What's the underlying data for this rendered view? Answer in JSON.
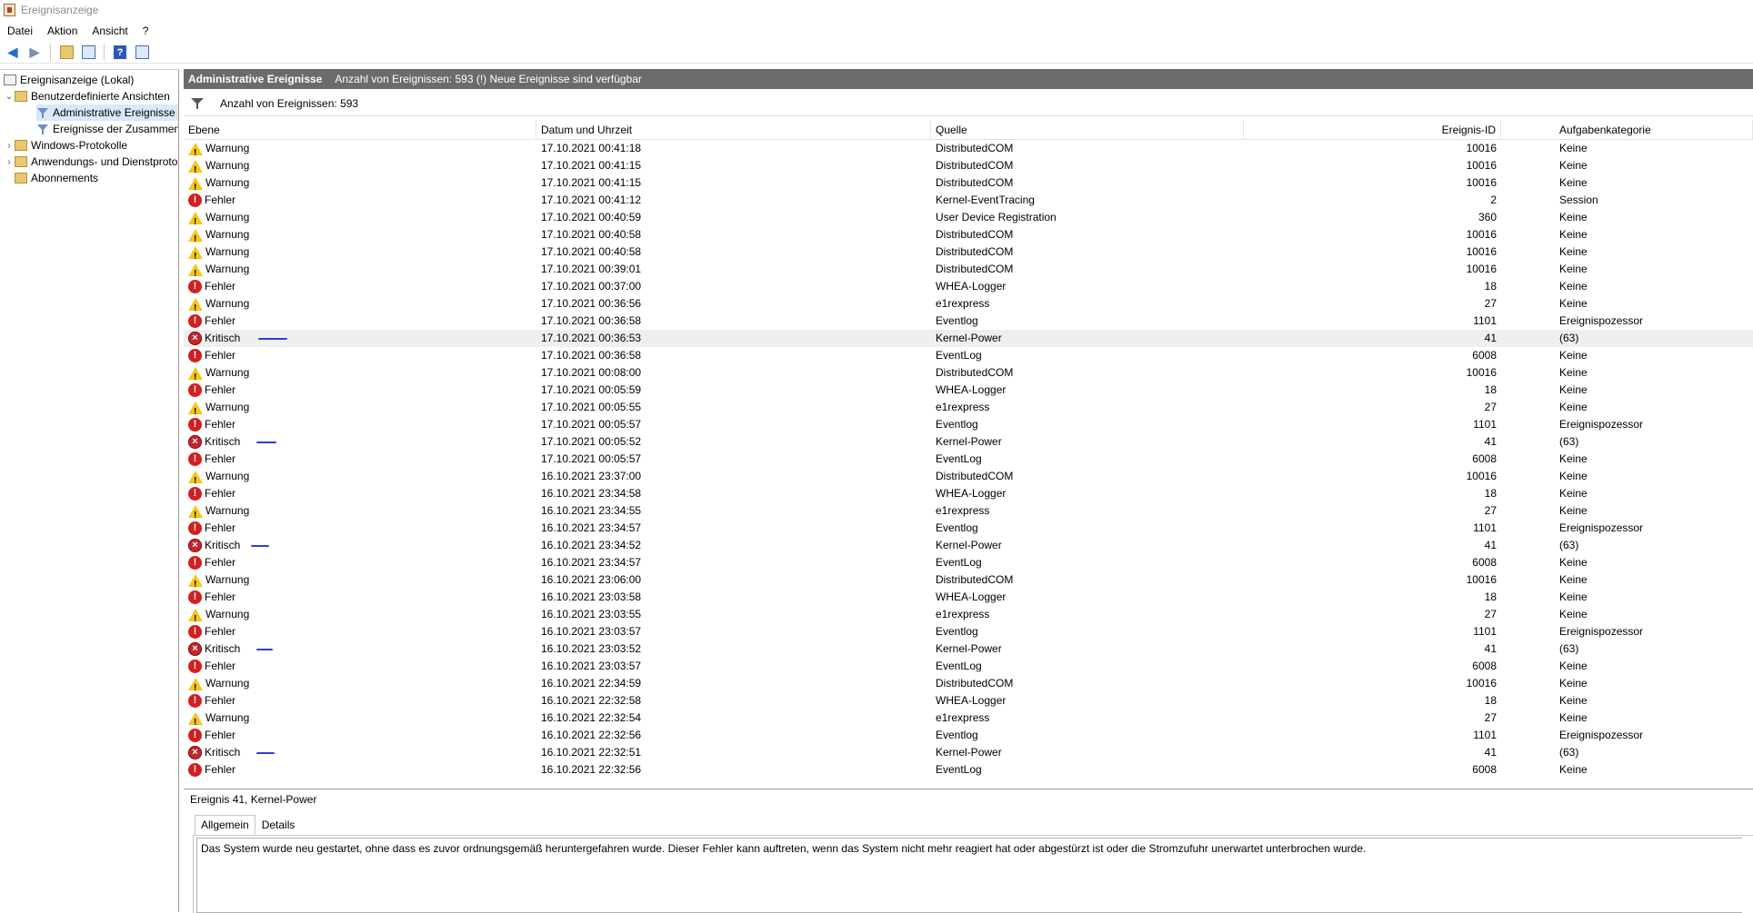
{
  "window": {
    "title": "Ereignisanzeige"
  },
  "menu": [
    "Datei",
    "Aktion",
    "Ansicht",
    "?"
  ],
  "toolbar": {
    "icons": [
      "back-arrow-icon",
      "forward-arrow-icon",
      "folder-up-icon",
      "properties-icon",
      "help-icon",
      "panel-icon"
    ]
  },
  "tree": {
    "root": "Ereignisanzeige (Lokal)",
    "custom_views": "Benutzerdefinierte Ansichten",
    "admin_events": "Administrative Ereignisse",
    "summary_events": "Ereignisse der Zusammenfassung",
    "windows_logs": "Windows-Protokolle",
    "app_service_logs": "Anwendungs- und Dienstprotokolle",
    "subscriptions": "Abonnements"
  },
  "header": {
    "title": "Administrative Ereignisse",
    "status": "Anzahl von Ereignissen: 593 (!) Neue Ereignisse sind verfügbar"
  },
  "filter": {
    "text": "Anzahl von Ereignissen: 593"
  },
  "columns": {
    "level": "Ebene",
    "date": "Datum und Uhrzeit",
    "source": "Quelle",
    "event_id": "Ereignis-ID",
    "category": "Aufgabenkategorie"
  },
  "events": [
    {
      "level": "Warnung",
      "date": "17.10.2021 00:41:18",
      "source": "DistributedCOM",
      "id": "10016",
      "category": "Keine"
    },
    {
      "level": "Warnung",
      "date": "17.10.2021 00:41:15",
      "source": "DistributedCOM",
      "id": "10016",
      "category": "Keine"
    },
    {
      "level": "Warnung",
      "date": "17.10.2021 00:41:15",
      "source": "DistributedCOM",
      "id": "10016",
      "category": "Keine"
    },
    {
      "level": "Fehler",
      "date": "17.10.2021 00:41:12",
      "source": "Kernel-EventTracing",
      "id": "2",
      "category": "Session"
    },
    {
      "level": "Warnung",
      "date": "17.10.2021 00:40:59",
      "source": "User Device Registration",
      "id": "360",
      "category": "Keine"
    },
    {
      "level": "Warnung",
      "date": "17.10.2021 00:40:58",
      "source": "DistributedCOM",
      "id": "10016",
      "category": "Keine"
    },
    {
      "level": "Warnung",
      "date": "17.10.2021 00:40:58",
      "source": "DistributedCOM",
      "id": "10016",
      "category": "Keine"
    },
    {
      "level": "Warnung",
      "date": "17.10.2021 00:39:01",
      "source": "DistributedCOM",
      "id": "10016",
      "category": "Keine"
    },
    {
      "level": "Fehler",
      "date": "17.10.2021 00:37:00",
      "source": "WHEA-Logger",
      "id": "18",
      "category": "Keine"
    },
    {
      "level": "Warnung",
      "date": "17.10.2021 00:36:56",
      "source": "e1rexpress",
      "id": "27",
      "category": "Keine"
    },
    {
      "level": "Fehler",
      "date": "17.10.2021 00:36:58",
      "source": "Eventlog",
      "id": "1101",
      "category": "Ereignispozessor"
    },
    {
      "level": "Kritisch",
      "date": "17.10.2021 00:36:53",
      "source": "Kernel-Power",
      "id": "41",
      "category": "(63)"
    },
    {
      "level": "Fehler",
      "date": "17.10.2021 00:36:58",
      "source": "EventLog",
      "id": "6008",
      "category": "Keine"
    },
    {
      "level": "Warnung",
      "date": "17.10.2021 00:08:00",
      "source": "DistributedCOM",
      "id": "10016",
      "category": "Keine"
    },
    {
      "level": "Fehler",
      "date": "17.10.2021 00:05:59",
      "source": "WHEA-Logger",
      "id": "18",
      "category": "Keine"
    },
    {
      "level": "Warnung",
      "date": "17.10.2021 00:05:55",
      "source": "e1rexpress",
      "id": "27",
      "category": "Keine"
    },
    {
      "level": "Fehler",
      "date": "17.10.2021 00:05:57",
      "source": "Eventlog",
      "id": "1101",
      "category": "Ereignispozessor"
    },
    {
      "level": "Kritisch",
      "date": "17.10.2021 00:05:52",
      "source": "Kernel-Power",
      "id": "41",
      "category": "(63)"
    },
    {
      "level": "Fehler",
      "date": "17.10.2021 00:05:57",
      "source": "EventLog",
      "id": "6008",
      "category": "Keine"
    },
    {
      "level": "Warnung",
      "date": "16.10.2021 23:37:00",
      "source": "DistributedCOM",
      "id": "10016",
      "category": "Keine"
    },
    {
      "level": "Fehler",
      "date": "16.10.2021 23:34:58",
      "source": "WHEA-Logger",
      "id": "18",
      "category": "Keine"
    },
    {
      "level": "Warnung",
      "date": "16.10.2021 23:34:55",
      "source": "e1rexpress",
      "id": "27",
      "category": "Keine"
    },
    {
      "level": "Fehler",
      "date": "16.10.2021 23:34:57",
      "source": "Eventlog",
      "id": "1101",
      "category": "Ereignispozessor"
    },
    {
      "level": "Kritisch",
      "date": "16.10.2021 23:34:52",
      "source": "Kernel-Power",
      "id": "41",
      "category": "(63)"
    },
    {
      "level": "Fehler",
      "date": "16.10.2021 23:34:57",
      "source": "EventLog",
      "id": "6008",
      "category": "Keine"
    },
    {
      "level": "Warnung",
      "date": "16.10.2021 23:06:00",
      "source": "DistributedCOM",
      "id": "10016",
      "category": "Keine"
    },
    {
      "level": "Fehler",
      "date": "16.10.2021 23:03:58",
      "source": "WHEA-Logger",
      "id": "18",
      "category": "Keine"
    },
    {
      "level": "Warnung",
      "date": "16.10.2021 23:03:55",
      "source": "e1rexpress",
      "id": "27",
      "category": "Keine"
    },
    {
      "level": "Fehler",
      "date": "16.10.2021 23:03:57",
      "source": "Eventlog",
      "id": "1101",
      "category": "Ereignispozessor"
    },
    {
      "level": "Kritisch",
      "date": "16.10.2021 23:03:52",
      "source": "Kernel-Power",
      "id": "41",
      "category": "(63)"
    },
    {
      "level": "Fehler",
      "date": "16.10.2021 23:03:57",
      "source": "EventLog",
      "id": "6008",
      "category": "Keine"
    },
    {
      "level": "Warnung",
      "date": "16.10.2021 22:34:59",
      "source": "DistributedCOM",
      "id": "10016",
      "category": "Keine"
    },
    {
      "level": "Fehler",
      "date": "16.10.2021 22:32:58",
      "source": "WHEA-Logger",
      "id": "18",
      "category": "Keine"
    },
    {
      "level": "Warnung",
      "date": "16.10.2021 22:32:54",
      "source": "e1rexpress",
      "id": "27",
      "category": "Keine"
    },
    {
      "level": "Fehler",
      "date": "16.10.2021 22:32:56",
      "source": "Eventlog",
      "id": "1101",
      "category": "Ereignispozessor"
    },
    {
      "level": "Kritisch",
      "date": "16.10.2021 22:32:51",
      "source": "Kernel-Power",
      "id": "41",
      "category": "(63)"
    },
    {
      "level": "Fehler",
      "date": "16.10.2021 22:32:56",
      "source": "EventLog",
      "id": "6008",
      "category": "Keine"
    }
  ],
  "selected_row": 11,
  "detail": {
    "title": "Ereignis 41, Kernel-Power",
    "tabs": [
      "Allgemein",
      "Details"
    ],
    "active_tab": "Allgemein",
    "description": "Das System wurde neu gestartet, ohne dass es zuvor ordnungsgemäß heruntergefahren wurde. Dieser Fehler kann auftreten, wenn das System nicht mehr reagiert hat oder abgestürzt ist oder die Stromzufuhr unerwartet unterbrochen wurde."
  },
  "colors": {
    "header_bg": "#6b6b6b",
    "warning": "#f5c518",
    "error": "#d21f1f",
    "critical": "#c2272d",
    "annotation": "#2b3fd6"
  }
}
